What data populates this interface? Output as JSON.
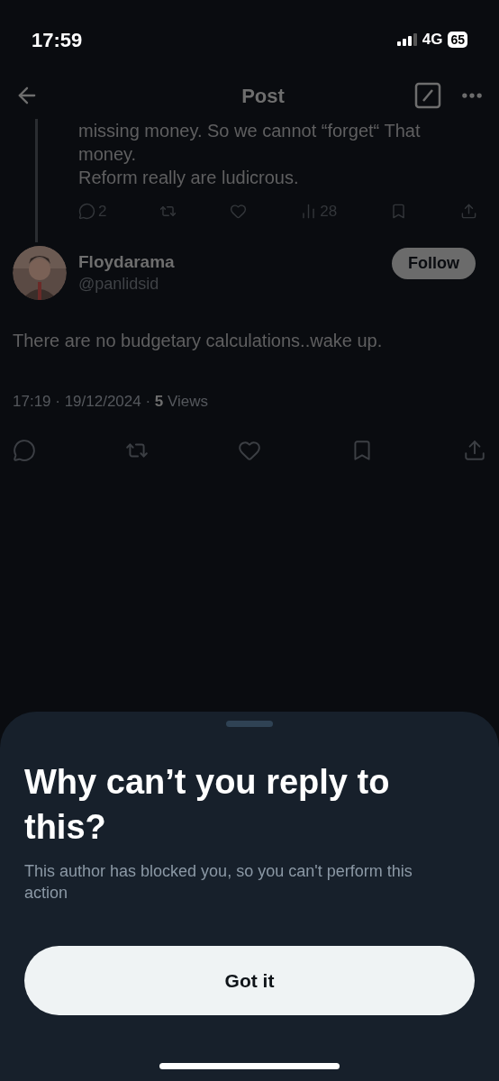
{
  "status_bar": {
    "time": "17:59",
    "network": "4G",
    "battery": "65"
  },
  "header": {
    "title": "Post"
  },
  "parent_post": {
    "lines": [
      "missing money. So we cannot “forget“ That money.",
      "Reform really are ludicrous."
    ],
    "actions": [
      {
        "kind": "reply",
        "count": "2"
      },
      {
        "kind": "repost"
      },
      {
        "kind": "like"
      },
      {
        "kind": "views",
        "count": "28"
      },
      {
        "kind": "bookmark"
      },
      {
        "kind": "share"
      }
    ]
  },
  "post": {
    "author": {
      "name": "Floydarama",
      "handle": "@panlidsid"
    },
    "follow_button": "Follow",
    "text": "There are no budgetary calculations..wake up.",
    "meta": "17:19 · 19/12/2024 · **5** Views",
    "actions": [
      {
        "kind": "reply"
      },
      {
        "kind": "repost"
      },
      {
        "kind": "like"
      },
      {
        "kind": "bookmark"
      },
      {
        "kind": "share"
      }
    ]
  },
  "sheet": {
    "title": "Why can’t you reply to this?",
    "message": "This author has blocked you, so you can't perform this action",
    "button": "Got it"
  }
}
